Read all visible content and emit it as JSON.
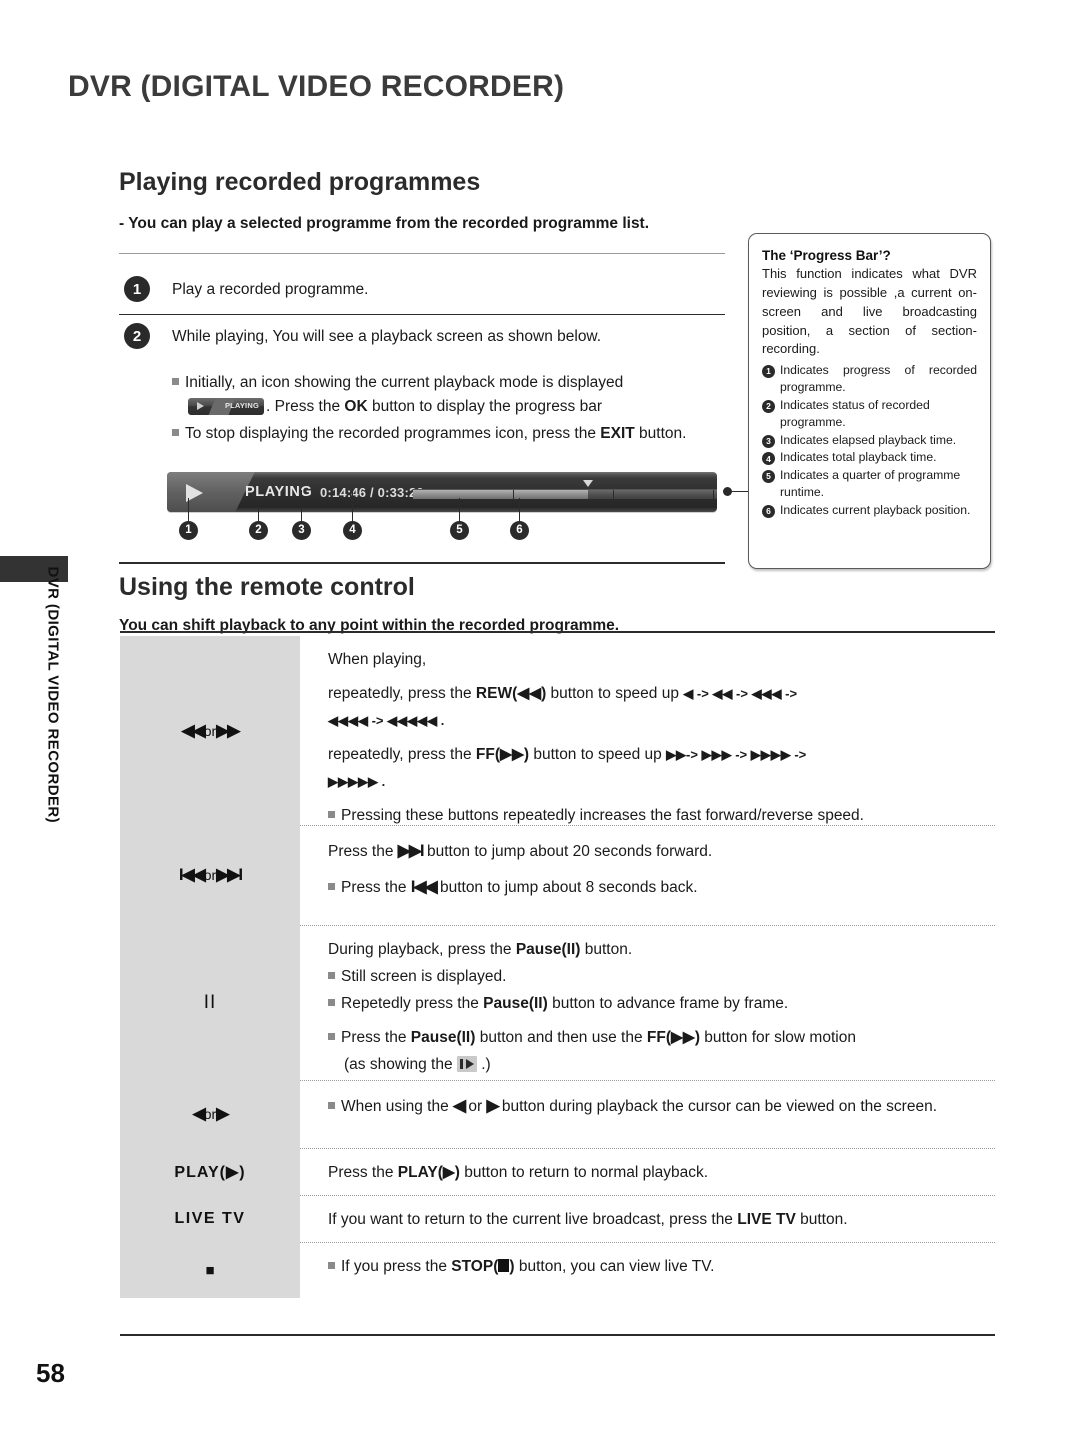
{
  "chapter_title": "DVR (DIGITAL VIDEO RECORDER)",
  "side_tab_label": "DVR (DIGITAL VIDEO RECORDER)",
  "page_number": "58",
  "section_playing": {
    "heading": "Playing recorded programmes",
    "lead": "-  You can play a selected programme from the recorded programme list.",
    "steps": [
      {
        "num": "1",
        "text": "Play a recorded programme."
      },
      {
        "num": "2",
        "text": "While playing, You will see a playback screen as shown below."
      }
    ],
    "bullets": {
      "b1_line1": "Initially, an icon showing the current playback mode is displayed",
      "b1_badge_label": "PLAYING",
      "b1_line2_pre": ". Press the ",
      "b1_line2_key": "OK",
      "b1_line2_post": " button to display the progress bar",
      "b2_pre": "To stop displaying the recorded programmes icon, press the ",
      "b2_key": "EXIT",
      "b2_post": " button."
    }
  },
  "progress_bar": {
    "status": "PLAYING",
    "elapsed": "0:14:46",
    "separator": "/",
    "total": "0:33:20",
    "time_combined": "0:14:46 / 0:33:20",
    "callouts": [
      "1",
      "2",
      "3",
      "4",
      "5",
      "6"
    ]
  },
  "info_box": {
    "title": "The ‘Progress Bar’?",
    "body": "This function indicates what DVR reviewing is possible ,a current on-screen and live broadcasting position, a section of section-recording.",
    "items": [
      {
        "num": "1",
        "text": "Indicates progress of recorded programme."
      },
      {
        "num": "2",
        "text": "Indicates status of recorded programme."
      },
      {
        "num": "3",
        "text": "Indicates elapsed playback time."
      },
      {
        "num": "4",
        "text": "Indicates total playback time."
      },
      {
        "num": "5",
        "text": "Indicates a quarter of programme runtime."
      },
      {
        "num": "6",
        "text": "Indicates current playback position."
      }
    ]
  },
  "section_remote": {
    "heading": "Using the remote control",
    "lead": "You can shift playback to any point within the recorded programme.",
    "rows": {
      "rew_ff": {
        "key_left": "◀◀",
        "key_or": " or ",
        "key_right": "▶▶",
        "line1": "When playing,",
        "line2_pre": "repeatedly, press the ",
        "line2_key": "REW(◀◀)",
        "line2_post": " button to speed up ",
        "line2_seq": "◀ -> ◀◀ -> ◀◀◀ ->",
        "line3_seq": "◀◀◀◀ -> ◀◀◀◀◀ .",
        "line4_pre": "repeatedly, press the ",
        "line4_key": "FF(▶▶)",
        "line4_post": " button to speed up ",
        "line4_seq": "▶▶-> ▶▶▶ -> ▶▶▶▶ ->",
        "line5_seq": "▶▶▶▶▶ .",
        "note": "Pressing these buttons repeatedly increases the fast forward/reverse speed."
      },
      "skip": {
        "key_left": "I◀◀",
        "key_or": " or ",
        "key_right": "▶▶I",
        "line1_pre": "Press the ",
        "line1_key": "▶▶I",
        "line1_post": " button to jump about 20 seconds forward.",
        "note_pre": "Press the ",
        "note_key": "I◀◀",
        "note_post": " button to jump about 8 seconds back."
      },
      "pause": {
        "key": "II",
        "line1_pre": "During playback, press the ",
        "line1_key": "Pause(II)",
        "line1_post": " button.",
        "note1": "Still screen is displayed.",
        "note2_pre": "Repetedly press the ",
        "note2_key": "Pause(II)",
        "note2_post": " button to advance frame by frame.",
        "note3_pre": "Press the ",
        "note3_key1": "Pause(II)",
        "note3_mid": " button and then use the ",
        "note3_key2": "FF(▶▶)",
        "note3_post": " button for slow motion",
        "note3_line2_pre": "(as showing the ",
        "note3_line2_post": ".)"
      },
      "cursor": {
        "key_left": "◀",
        "key_or": " or ",
        "key_right": "▶",
        "note_pre": "When using the ",
        "note_k1": "◀",
        "note_mid": " or ",
        "note_k2": "▶",
        "note_post": " button during playback the cursor can be viewed on the screen."
      },
      "play": {
        "key": "PLAY(▶)",
        "line_pre": "Press the ",
        "line_key": "PLAY(▶)",
        "line_post": " button to return to normal playback."
      },
      "livetv": {
        "key": "LIVE TV",
        "line_pre": "If you want to return to the current live broadcast, press the ",
        "line_key": "LIVE TV",
        "line_post": " button."
      },
      "stop": {
        "key": "■",
        "line_pre": "If you press the ",
        "line_key": "STOP(",
        "line_key2": ")",
        "line_post": " button, you can view live TV."
      }
    }
  }
}
